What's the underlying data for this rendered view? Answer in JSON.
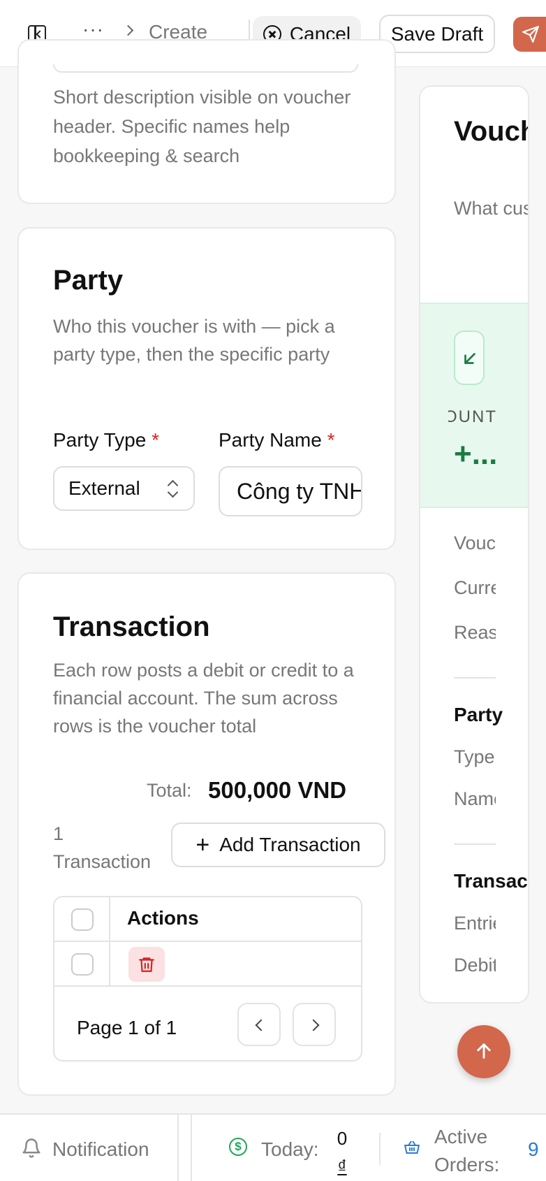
{
  "topbar": {
    "ellipsis": "···",
    "breadcrumb_current": "Create",
    "cancel_label": "Cancel",
    "save_draft_label": "Save Draft"
  },
  "description_card": {
    "help_text": "Short description visible on voucher header. Specific names help bookkeeping & search"
  },
  "party_card": {
    "title": "Party",
    "help_text": "Who this voucher is with — pick a party type, then the specific party",
    "party_type_label": "Party Type",
    "party_type_value": "External",
    "party_name_label": "Party Name",
    "party_name_value": "Công ty TNHH",
    "required_mark": "*"
  },
  "transaction_card": {
    "title": "Transaction",
    "help_text": "Each row posts a debit or credit to a financial account. The sum across rows is the voucher total",
    "total_label": "Total:",
    "total_value": "500,000 VND",
    "count_text": "1 Transaction",
    "add_label": "Add Transaction",
    "table": {
      "columns": [
        "Actions"
      ],
      "rows": 1
    },
    "pagination": "Page 1 of 1"
  },
  "preview": {
    "title": "Voucher Preview",
    "subtitle": "What customers will see",
    "amount_label": "AMOUNT",
    "amount_value": "+...",
    "rows": [
      "Voucher",
      "Currency",
      "Reason"
    ],
    "party_heading": "Party",
    "party_rows": [
      "Type",
      "Name"
    ],
    "transaction_heading": "Transaction",
    "transaction_rows": [
      "Entries",
      "Debit"
    ]
  },
  "statusbar": {
    "notification_label": "Notification",
    "today_label": "Today:",
    "today_value": "0",
    "today_currency": "₫",
    "orders_label": "Active Orders:",
    "orders_value": "9"
  },
  "colors": {
    "accent": "#d2674b",
    "success": "#22a559",
    "danger": "#d22222",
    "link": "#2b7bd8"
  }
}
